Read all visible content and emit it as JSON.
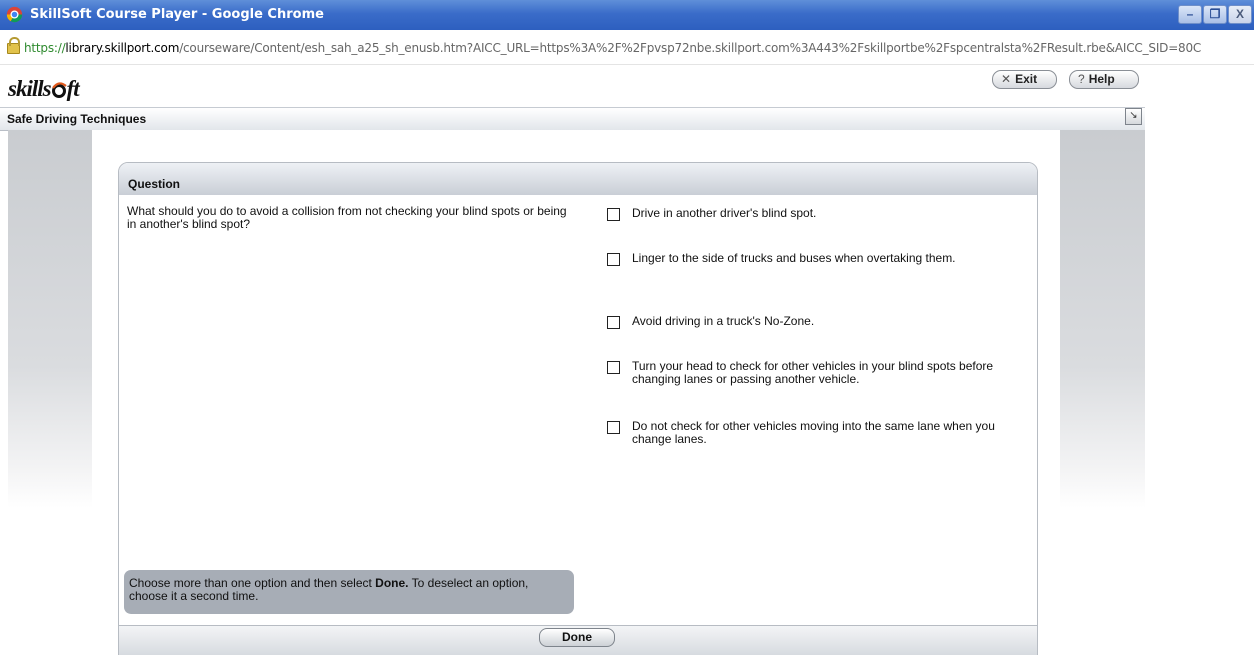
{
  "window": {
    "title": "SkillSoft Course Player - Google Chrome",
    "minimize_glyph": "–",
    "maximize_glyph": "❐",
    "close_glyph": "X"
  },
  "address_bar": {
    "scheme": "https://",
    "host": "library.skillport.com",
    "path": "/courseware/Content/esh_sah_a25_sh_enusb.htm?AICC_URL=https%3A%2F%2Fpvsp72nbe.skillport.com%3A443%2Fskillportbe%2Fspcentralsta%2FResult.rbe&AICC_SID=80C"
  },
  "header": {
    "brand_left": "skills",
    "brand_right": "ft",
    "exit_label": "Exit",
    "help_label": "Help"
  },
  "course": {
    "title": "Safe Driving Techniques"
  },
  "question": {
    "header_label": "Question",
    "text": "What should you do to avoid a collision from not checking your blind spots or being in another's blind spot?",
    "options": [
      {
        "label": "Drive in another driver's blind spot.",
        "checked": false
      },
      {
        "label": "Linger to the side of trucks and buses when overtaking them.",
        "checked": false
      },
      {
        "label": "Avoid driving in a truck's No-Zone.",
        "checked": false
      },
      {
        "label": "Turn your head to check for other vehicles in your blind spots before changing lanes or passing another vehicle.",
        "checked": false
      },
      {
        "label": "Do not check for other vehicles moving into the same lane when you change lanes.",
        "checked": false
      }
    ]
  },
  "instruction": {
    "before": "Choose more than one option and then select ",
    "bold": "Done.",
    "after": " To deselect an option, choose it a second time."
  },
  "footer": {
    "done_label": "Done"
  },
  "icons": {
    "exit": "x-icon",
    "help": "question-icon",
    "expand": "expand-icon"
  }
}
